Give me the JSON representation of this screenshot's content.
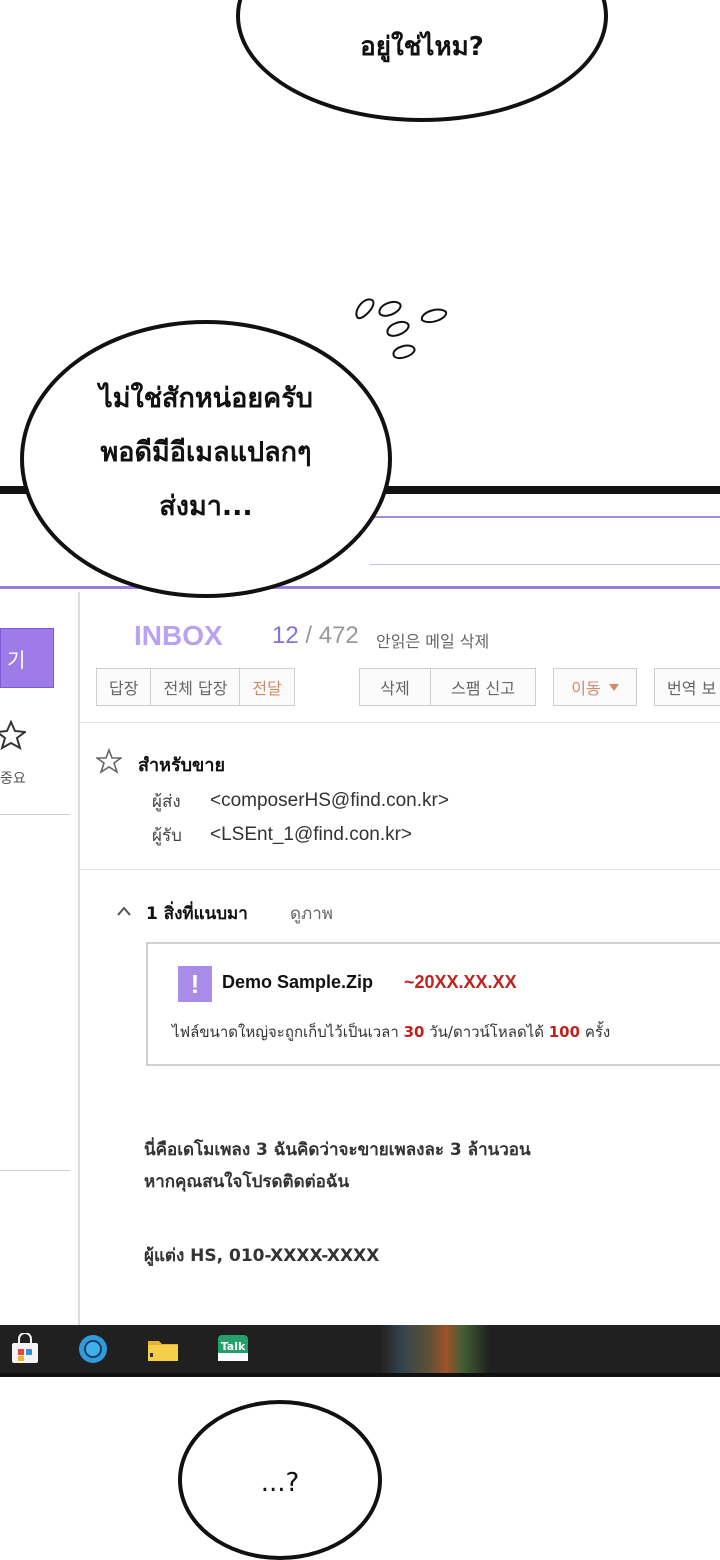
{
  "bubbles": {
    "top": "อยู่ใช่ไหม?",
    "middle_lines": [
      "ไม่ใช่สักหน่อยครับ",
      "พอดีมีอีเมลแปลกๆ",
      "ส่งมา..."
    ],
    "bottom": "...?"
  },
  "mail": {
    "sidebar": {
      "write_label": "기",
      "important_label": "중요"
    },
    "folder_title": "INBOX",
    "unread_count": "12",
    "separator": "/",
    "total_count": "472",
    "delete_unread": "안읽은 메일 삭제",
    "toolbar": {
      "reply": "답장",
      "reply_all": "전체 답장",
      "forward": "전달",
      "delete": "삭제",
      "spam": "스팸 신고",
      "move": "이동",
      "translate": "번역 보"
    },
    "message": {
      "subject": "สำหรับขาย",
      "from_label": "ผู้ส่ง",
      "from_value": "<composerHS@find.con.kr>",
      "to_label": "ผู้รับ",
      "to_value": "<LSEnt_1@find.con.kr>"
    },
    "attachments": {
      "title": "1 สิ่งที่แนบมา",
      "view_label": "ดูภาพ",
      "file_icon_glyph": "!",
      "file_name": "Demo Sample.Zip",
      "file_date": "~20XX.XX.XX",
      "note_prefix": "ไฟล์ขนาดใหญ่จะถูกเก็บไว้เป็นเวลา",
      "note_days": "30",
      "note_middle": "วัน/ดาวน์โหลดได้",
      "note_downloads": "100",
      "note_suffix": "ครั้ง"
    },
    "body": {
      "line1": "นี่คือเดโมเพลง 3 ฉันคิดว่าจะขายเพลงละ 3 ล้านวอน",
      "line2": "หากคุณสนใจโปรดติดต่อฉัน",
      "signature": "ผู้แต่ง HS, 010-XXXX-XXXX"
    }
  },
  "taskbar": {
    "icons": [
      "store-icon",
      "browser-icon",
      "folder-icon",
      "talk-icon"
    ],
    "talk_label": "Talk"
  },
  "colors": {
    "accent_purple": "#9e7be8",
    "inbox_title": "#b9a2f2",
    "date_red": "#c0231e"
  }
}
